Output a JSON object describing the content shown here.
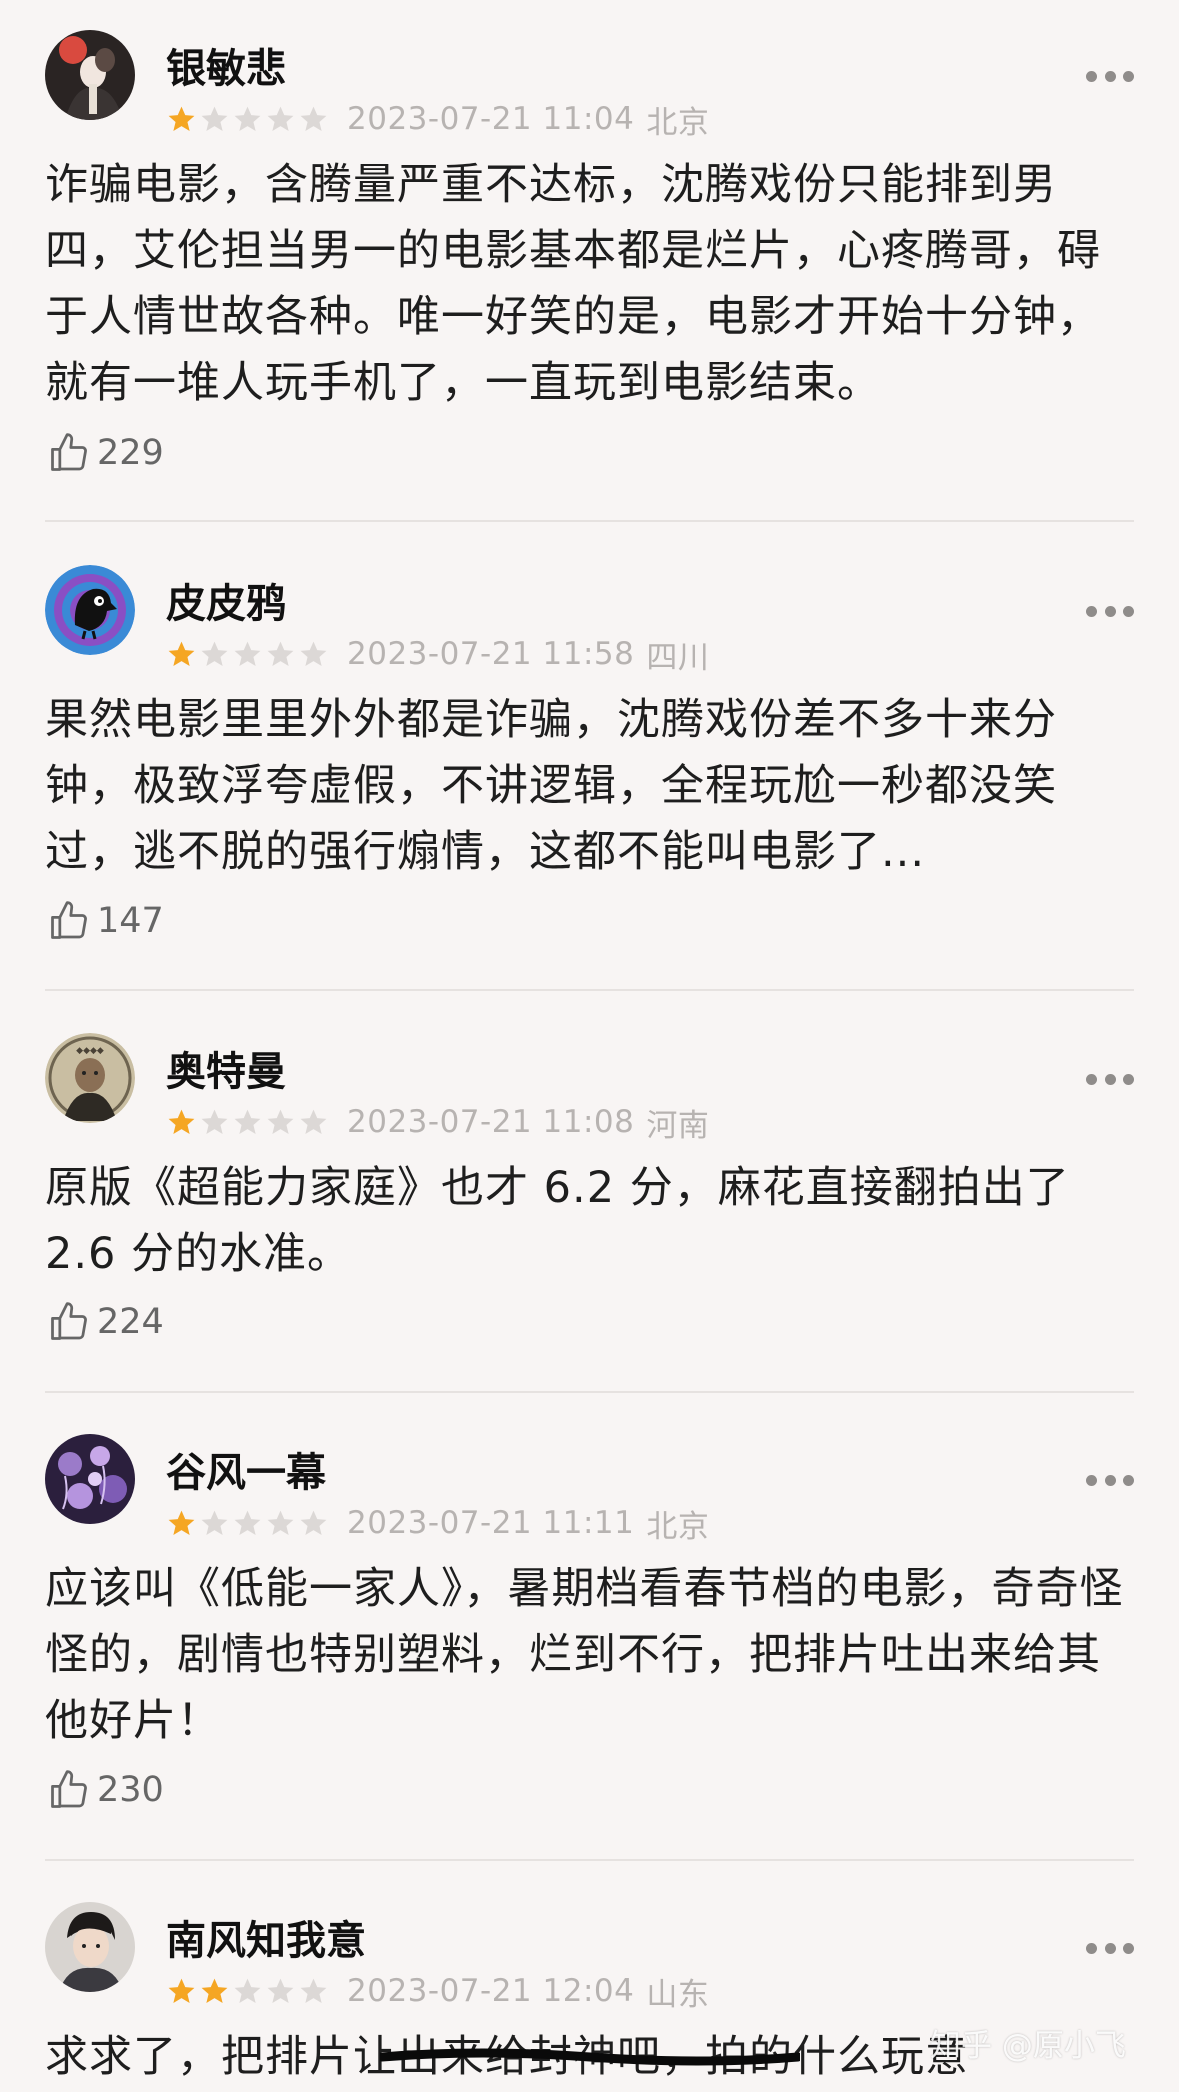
{
  "reviews": [
    {
      "username": "银敏悲",
      "rating": 1,
      "max_rating": 5,
      "timestamp": "2023-07-21 11:04",
      "location": "北京",
      "content": "诈骗电影，含腾量严重不达标，沈腾戏份只能排到男四，艾伦担当男一的电影基本都是烂片，心疼腾哥，碍于人情世故各种。唯一好笑的是，电影才开始十分钟，就有一堆人玩手机了，一直玩到电影结束。",
      "likes": "229"
    },
    {
      "username": "皮皮鸦",
      "rating": 1,
      "max_rating": 5,
      "timestamp": "2023-07-21 11:58",
      "location": "四川",
      "content": "果然电影里里外外都是诈骗，沈腾戏份差不多十来分钟，极致浮夸虚假，不讲逻辑，全程玩尬一秒都没笑过，逃不脱的强行煽情，这都不能叫电影了...",
      "likes": "147"
    },
    {
      "username": "奥特曼",
      "rating": 1,
      "max_rating": 5,
      "timestamp": "2023-07-21 11:08",
      "location": "河南",
      "content": "原版《超能力家庭》也才 6.2 分，麻花直接翻拍出了 2.6 分的水准。",
      "likes": "224"
    },
    {
      "username": "谷风一幕",
      "rating": 1,
      "max_rating": 5,
      "timestamp": "2023-07-21 11:11",
      "location": "北京",
      "content": "应该叫《低能一家人》，暑期档看春节档的电影，奇奇怪怪的，剧情也特别塑料，烂到不行，把排片吐出来给其他好片！",
      "likes": "230"
    },
    {
      "username": "南风知我意",
      "rating": 2,
      "max_rating": 5,
      "timestamp": "2023-07-21 12:04",
      "location": "山东",
      "content": "求求了，把排片让出来给封神吧，拍的什么玩意",
      "likes": ""
    }
  ],
  "watermark": "知乎 @原小飞",
  "colors": {
    "star_filled": "#f5a623",
    "star_empty": "#dcd8d6",
    "background": "#f8f5f4",
    "meta_text": "#b7b3b1"
  },
  "icons": {
    "more": "more-dots-icon",
    "like": "thumbs-up-icon",
    "star": "star-icon"
  }
}
